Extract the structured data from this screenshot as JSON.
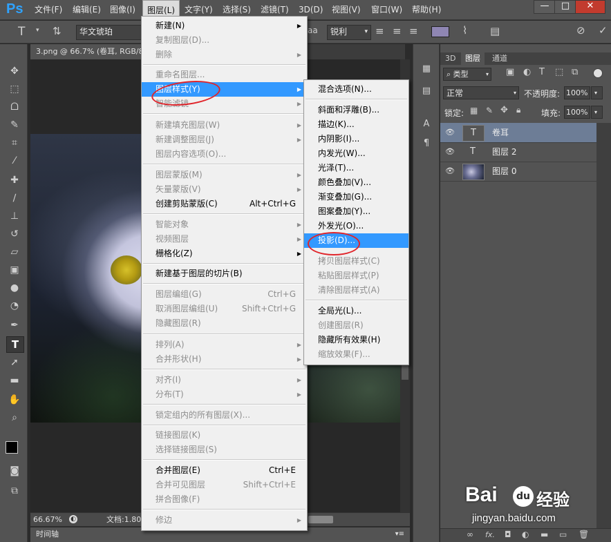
{
  "app": {
    "logo": "Ps"
  },
  "menubar": {
    "items": [
      "文件(F)",
      "编辑(E)",
      "图像(I)",
      "图层(L)",
      "文字(Y)",
      "选择(S)",
      "滤镜(T)",
      "3D(D)",
      "视图(V)",
      "窗口(W)",
      "帮助(H)"
    ],
    "active_index": 3,
    "window_buttons": [
      "—",
      "□",
      "✕"
    ]
  },
  "options_bar": {
    "font_family": "华文琥珀",
    "antialias": "锐利",
    "aa_label": "aa",
    "text_color": "#8f86b3"
  },
  "document": {
    "tab_title": "3.png @ 66.7% (卷耳, RGB/8",
    "zoom": "66.67%",
    "doc_info": "文档:1.80"
  },
  "timeline": {
    "label": "时间轴"
  },
  "layers_panel": {
    "tabs": [
      "3D",
      "图层",
      "通道"
    ],
    "active_tab": 1,
    "filter_kind": "类型",
    "blend_mode": "正常",
    "opacity_label": "不透明度:",
    "opacity_value": "100%",
    "lock_label": "锁定:",
    "fill_label": "填充:",
    "fill_value": "100%",
    "layers": [
      {
        "name": "卷耳",
        "thumb": "T",
        "selected": true
      },
      {
        "name": "图层 2",
        "thumb": "T",
        "selected": false
      },
      {
        "name": "图层 0",
        "thumb": "",
        "selected": false
      }
    ],
    "bottom_icons": [
      "link-icon",
      "fx-icon",
      "mask-icon",
      "adjustment-icon",
      "group-icon",
      "new-layer-icon",
      "trash-icon"
    ],
    "fx_label": "fx."
  },
  "layer_menu": {
    "items": [
      {
        "label": "新建(N)",
        "shortcut": "",
        "submenu": true,
        "disabled": false
      },
      {
        "label": "复制图层(D)...",
        "shortcut": "",
        "submenu": false,
        "disabled": true
      },
      {
        "label": "删除",
        "shortcut": "",
        "submenu": true,
        "disabled": true
      },
      {
        "label": "重命名图层...",
        "shortcut": "",
        "submenu": false,
        "disabled": true
      },
      {
        "label": "图层样式(Y)",
        "shortcut": "",
        "submenu": true,
        "disabled": false
      },
      {
        "label": "智能滤镜",
        "shortcut": "",
        "submenu": true,
        "disabled": true
      },
      {
        "label": "新建填充图层(W)",
        "shortcut": "",
        "submenu": true,
        "disabled": true
      },
      {
        "label": "新建调整图层(J)",
        "shortcut": "",
        "submenu": true,
        "disabled": true
      },
      {
        "label": "图层内容选项(O)...",
        "shortcut": "",
        "submenu": false,
        "disabled": true
      },
      {
        "label": "图层蒙版(M)",
        "shortcut": "",
        "submenu": true,
        "disabled": true
      },
      {
        "label": "矢量蒙版(V)",
        "shortcut": "",
        "submenu": true,
        "disabled": true
      },
      {
        "label": "创建剪贴蒙版(C)",
        "shortcut": "Alt+Ctrl+G",
        "submenu": false,
        "disabled": false
      },
      {
        "label": "智能对象",
        "shortcut": "",
        "submenu": true,
        "disabled": true
      },
      {
        "label": "视频图层",
        "shortcut": "",
        "submenu": true,
        "disabled": true
      },
      {
        "label": "栅格化(Z)",
        "shortcut": "",
        "submenu": true,
        "disabled": false
      },
      {
        "label": "新建基于图层的切片(B)",
        "shortcut": "",
        "submenu": false,
        "disabled": false
      },
      {
        "label": "图层编组(G)",
        "shortcut": "Ctrl+G",
        "submenu": false,
        "disabled": true
      },
      {
        "label": "取消图层编组(U)",
        "shortcut": "Shift+Ctrl+G",
        "submenu": false,
        "disabled": true
      },
      {
        "label": "隐藏图层(R)",
        "shortcut": "",
        "submenu": false,
        "disabled": true
      },
      {
        "label": "排列(A)",
        "shortcut": "",
        "submenu": true,
        "disabled": true
      },
      {
        "label": "合并形状(H)",
        "shortcut": "",
        "submenu": true,
        "disabled": true
      },
      {
        "label": "对齐(I)",
        "shortcut": "",
        "submenu": true,
        "disabled": true
      },
      {
        "label": "分布(T)",
        "shortcut": "",
        "submenu": true,
        "disabled": true
      },
      {
        "label": "锁定组内的所有图层(X)...",
        "shortcut": "",
        "submenu": false,
        "disabled": true
      },
      {
        "label": "链接图层(K)",
        "shortcut": "",
        "submenu": false,
        "disabled": true
      },
      {
        "label": "选择链接图层(S)",
        "shortcut": "",
        "submenu": false,
        "disabled": true
      },
      {
        "label": "合并图层(E)",
        "shortcut": "Ctrl+E",
        "submenu": false,
        "disabled": false
      },
      {
        "label": "合并可见图层",
        "shortcut": "Shift+Ctrl+E",
        "submenu": false,
        "disabled": true
      },
      {
        "label": "拼合图像(F)",
        "shortcut": "",
        "submenu": false,
        "disabled": true
      },
      {
        "label": "修边",
        "shortcut": "",
        "submenu": true,
        "disabled": true
      }
    ]
  },
  "style_submenu": {
    "items": [
      {
        "label": "混合选项(N)...",
        "disabled": false
      },
      {
        "label": "斜面和浮雕(B)...",
        "disabled": false
      },
      {
        "label": "描边(K)...",
        "disabled": false
      },
      {
        "label": "内阴影(I)...",
        "disabled": false
      },
      {
        "label": "内发光(W)...",
        "disabled": false
      },
      {
        "label": "光泽(T)...",
        "disabled": false
      },
      {
        "label": "颜色叠加(V)...",
        "disabled": false
      },
      {
        "label": "渐变叠加(G)...",
        "disabled": false
      },
      {
        "label": "图案叠加(Y)...",
        "disabled": false
      },
      {
        "label": "外发光(O)...",
        "disabled": false
      },
      {
        "label": "投影(D)...",
        "disabled": false
      },
      {
        "label": "拷贝图层样式(C)",
        "disabled": true
      },
      {
        "label": "粘贴图层样式(P)",
        "disabled": true
      },
      {
        "label": "清除图层样式(A)",
        "disabled": true
      },
      {
        "label": "全局光(L)...",
        "disabled": false
      },
      {
        "label": "创建图层(R)",
        "disabled": true
      },
      {
        "label": "隐藏所有效果(H)",
        "disabled": false
      },
      {
        "label": "缩放效果(F)...",
        "disabled": true
      }
    ],
    "highlighted_index": 10
  },
  "watermark": {
    "logo_left": "Bai",
    "logo_paw": "du",
    "logo_right": "经验",
    "url": "jingyan.baidu.com"
  }
}
